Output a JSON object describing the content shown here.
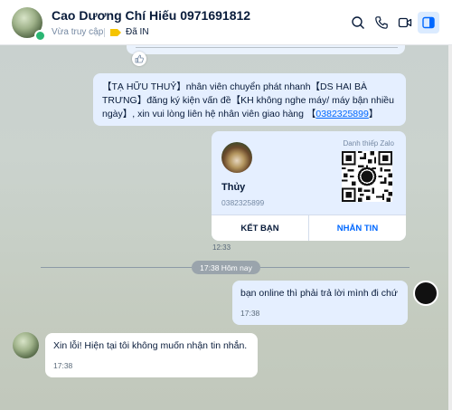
{
  "header": {
    "name": "Cao Dương Chí Hiếu 0971691812",
    "status": "Vừa truy cập",
    "tag": "Đã IN",
    "tag_color": "#f5c400",
    "icons": [
      "search-icon",
      "phone-icon",
      "video-icon",
      "sidebar-toggle-icon"
    ]
  },
  "messages": {
    "m1": {
      "text_a": "【TẠ HỮU THUỶ】nhân viên chuyển phát nhanh【DS HAI BÀ TRƯNG】đăng ký kiện vấn đề【KH không nghe máy/ máy bận nhiều ngày】, xin vui lòng liên hệ nhân viên giao hàng 【",
      "link": "0382325899",
      "text_b": "】"
    },
    "card": {
      "label": "Danh thiếp Zalo",
      "name": "Thủy",
      "phone": "0382325899",
      "button_add": "KẾT BẠN",
      "button_msg": "NHẮN TIN",
      "time": "12:33"
    },
    "date_separator": "17:38 Hôm nay",
    "m2": {
      "text": "bạn online thì phải trả lời mình đi chứ",
      "time": "17:38"
    },
    "m3": {
      "text": "Xin lỗi! Hiện tại tôi không muốn nhận tin nhắn.",
      "time": "17:38"
    }
  },
  "colors": {
    "accent": "#0068ff",
    "outgoing_bubble": "#e5efff",
    "online": "#2bb673"
  }
}
